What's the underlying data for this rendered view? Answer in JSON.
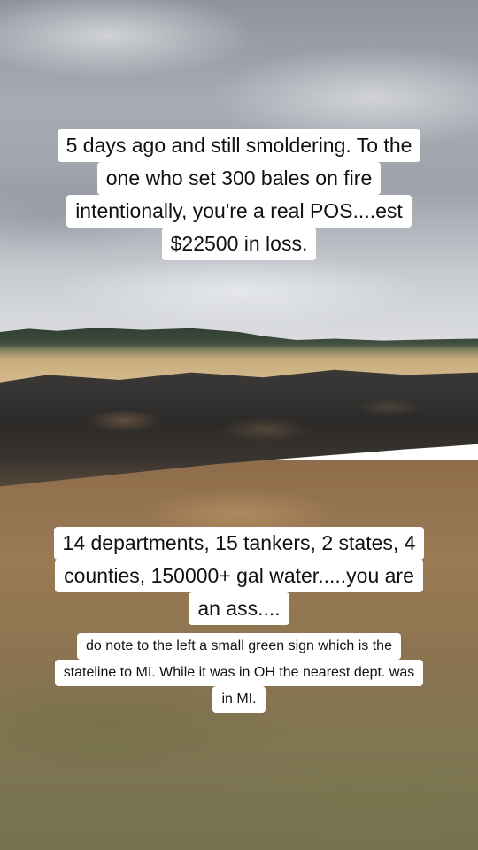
{
  "captions": {
    "top": [
      "5 days ago and still smoldering. To the",
      "one who set 300 bales on fire",
      "intentionally, you're a real POS....est",
      "$22500 in loss."
    ],
    "middle": [
      "14 departments, 15 tankers, 2 states, 4",
      "counties, 150000+ gal water.....you are",
      "an ass...."
    ],
    "bottom": [
      "do note to the left a small green sign which is the",
      "stateline to MI. While it was in OH the nearest dept. was",
      "in MI."
    ]
  },
  "colors": {
    "caption_background": "#ffffff",
    "caption_text": "#111111"
  }
}
